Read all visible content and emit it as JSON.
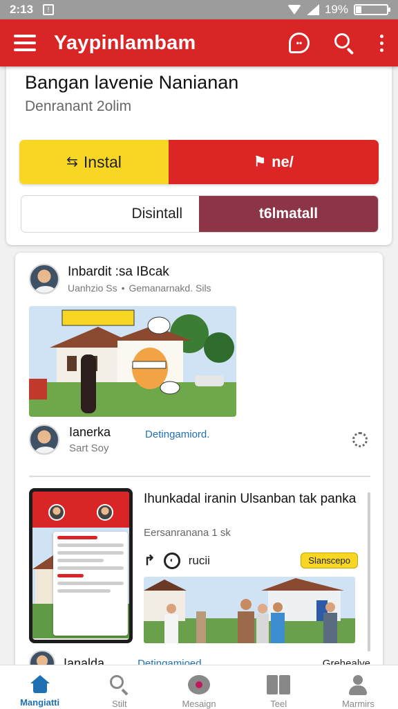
{
  "status_bar": {
    "time": "2:13",
    "battery": "19%",
    "battery_level": 0.19
  },
  "app_bar": {
    "title": "Yaypinlambam"
  },
  "hero": {
    "title": "Bangan lavenie Nanianan",
    "subtitle": "Denranant 2olim",
    "buttons": {
      "instal": "Instal",
      "neu": "ne/",
      "disinstall": "Disintall",
      "reinstall": "t6lmatall"
    }
  },
  "feed": {
    "post1": {
      "author": "Inbardit   :sa IBcak",
      "meta_left": "Uanhzio Ss",
      "meta_right": "Gemanarnakd. Sils",
      "user_name": "Ianerka",
      "user_sub": "Sart Soy",
      "link": "Detingamiord."
    },
    "post2": {
      "title": "Ihunkadal iranin Ulsanban tak panka",
      "meta": "Eersanranana 1 sk",
      "action": "rucii",
      "badge": "Slanscepo"
    },
    "row3": {
      "name": "Ianalda",
      "link": "Detingamioed",
      "right": "Grehealye"
    }
  },
  "bottom_nav": [
    {
      "label": "Mangiatti",
      "icon": "home-icon",
      "active": true
    },
    {
      "label": "Stilt",
      "icon": "search-icon",
      "active": false
    },
    {
      "label": "Mesaign",
      "icon": "message-icon",
      "active": false
    },
    {
      "label": "Teel",
      "icon": "book-icon",
      "active": false
    },
    {
      "label": "Marmirs",
      "icon": "person-icon",
      "active": false
    }
  ],
  "colors": {
    "primary_red": "#d92525",
    "yellow": "#f7d724",
    "maroon": "#8c3547",
    "link_blue": "#1f6fb3"
  }
}
